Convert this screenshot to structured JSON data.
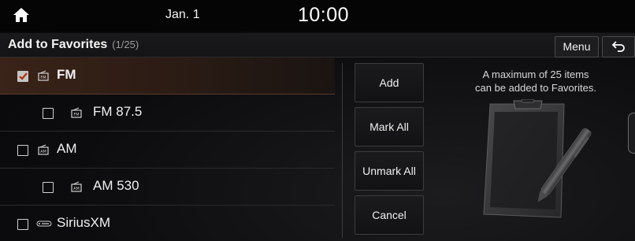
{
  "status": {
    "date": "Jan. 1",
    "time": "10:00"
  },
  "header": {
    "title": "Add to Favorites",
    "count": "(1/25)",
    "menu_label": "Menu"
  },
  "list": {
    "items": [
      {
        "label": "FM",
        "checked": true,
        "icon": "radio-fm-icon"
      },
      {
        "label": "FM 87.5",
        "checked": false,
        "icon": "radio-fm-icon"
      },
      {
        "label": "AM",
        "checked": false,
        "icon": "radio-am-icon"
      },
      {
        "label": "AM 530",
        "checked": false,
        "icon": "radio-am-icon"
      },
      {
        "label": "SiriusXM",
        "checked": false,
        "icon": "siriusxm-logo-icon"
      }
    ]
  },
  "actions": {
    "add": "Add",
    "mark_all": "Mark All",
    "unmark_all": "Unmark All",
    "cancel": "Cancel"
  },
  "info": {
    "line1": "A maximum of 25 items",
    "line2": "can be added to Favorites."
  },
  "colors": {
    "selected_row": "#3a2318",
    "background": "#0b0b0d"
  }
}
